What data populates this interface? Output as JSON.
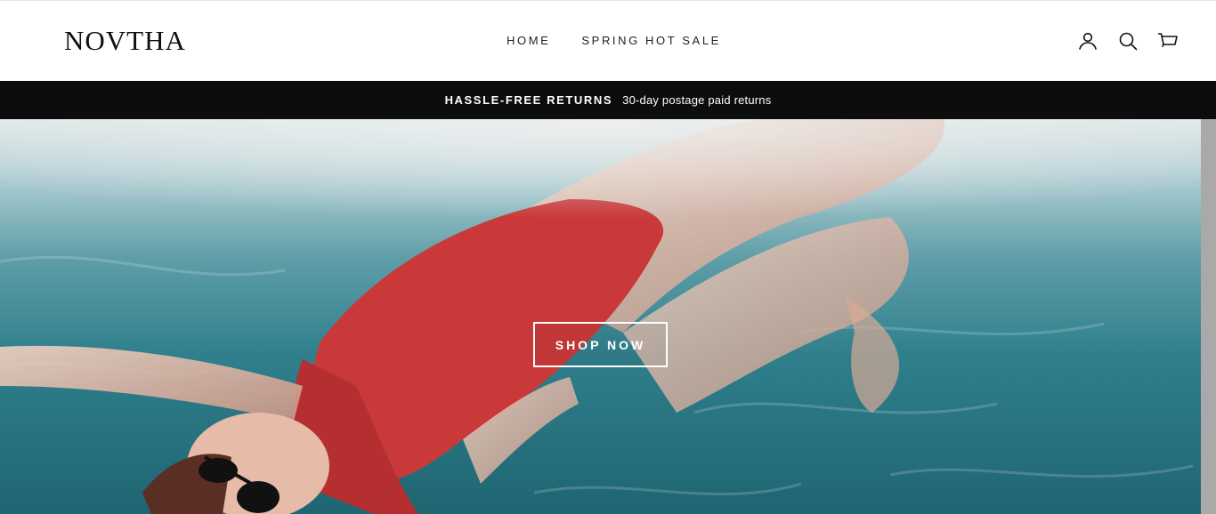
{
  "header": {
    "logo": "NOVTHA",
    "nav": [
      {
        "label": "HOME"
      },
      {
        "label": "SPRING HOT SALE"
      }
    ],
    "icons": [
      "account-icon",
      "search-icon",
      "cart-icon"
    ]
  },
  "announcement": {
    "title": "HASSLE-FREE RETURNS",
    "text": "30-day postage paid returns"
  },
  "hero": {
    "cta_label": "SHOP NOW"
  }
}
